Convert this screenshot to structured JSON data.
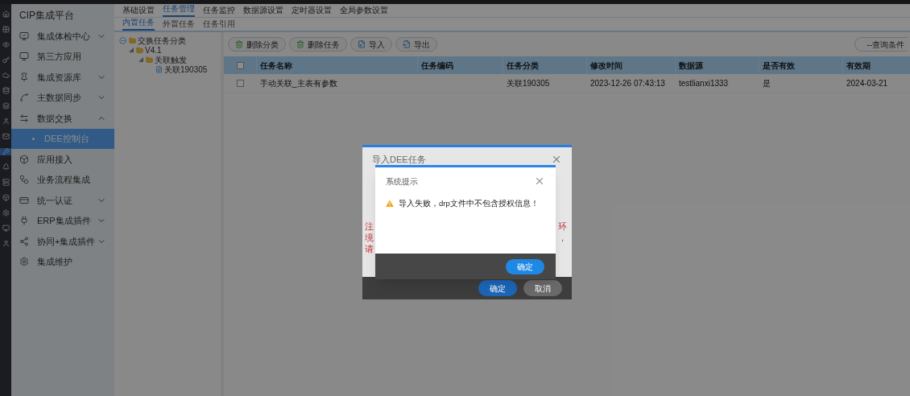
{
  "sidebar": {
    "title": "CIP集成平台",
    "items": [
      {
        "label": "集成体检中心",
        "expanded": false
      },
      {
        "label": "第三方应用"
      },
      {
        "label": "集成资源库",
        "expanded": false
      },
      {
        "label": "主数据同步",
        "expanded": false
      },
      {
        "label": "数据交换",
        "expanded": true,
        "children": [
          {
            "label": "DEE控制台",
            "selected": true
          }
        ]
      },
      {
        "label": "应用接入"
      },
      {
        "label": "业务流程集成"
      },
      {
        "label": "统一认证",
        "expanded": false
      },
      {
        "label": "ERP集成插件",
        "expanded": false
      },
      {
        "label": "协同+集成插件",
        "expanded": false
      },
      {
        "label": "集成维护"
      }
    ]
  },
  "top_tabs": [
    {
      "label": "基础设置",
      "selected": false
    },
    {
      "label": "任务管理",
      "selected": true
    },
    {
      "label": "任务监控",
      "selected": false
    },
    {
      "label": "数据源设置",
      "selected": false
    },
    {
      "label": "定时器设置",
      "selected": false
    },
    {
      "label": "全局参数设置",
      "selected": false
    }
  ],
  "sub_tabs": [
    {
      "label": "内置任务",
      "selected": true
    },
    {
      "label": "外置任务",
      "selected": false
    },
    {
      "label": "任务引用",
      "selected": false
    }
  ],
  "tree": [
    {
      "label": "交换任务分类",
      "kind": "root",
      "expanded": true,
      "children": [
        {
          "label": "V4.1",
          "kind": "folder",
          "expanded": true,
          "children": [
            {
              "label": "关联触发",
              "kind": "folder",
              "expanded": true,
              "children": [
                {
                  "label": "关联190305",
                  "kind": "file"
                }
              ]
            }
          ]
        }
      ]
    }
  ],
  "toolbar": [
    {
      "label": "删除分类",
      "kind": "delete"
    },
    {
      "label": "删除任务",
      "kind": "delete"
    },
    {
      "label": "导入",
      "kind": "import"
    },
    {
      "label": "导出",
      "kind": "export"
    }
  ],
  "query_button": "--查询条件",
  "table": {
    "all_checked": false,
    "columns": [
      "任务名称",
      "任务编码",
      "任务分类",
      "修改时间",
      "数据源",
      "是否有效",
      "有效期"
    ],
    "rows": [
      {
        "checked": false,
        "cells": [
          "手动关联_主表有参数",
          "",
          "关联190305",
          "2023-12-26 07:43:13",
          "testlianxi1333",
          "是",
          "2024-03-21"
        ]
      }
    ]
  },
  "import_dialog": {
    "title": "导入DEE任务",
    "note_left": [
      "注",
      "境",
      "请"
    ],
    "note_right": [
      "环",
      "，"
    ],
    "buttons": [
      {
        "label": "确定",
        "kind": "primary"
      },
      {
        "label": "取消",
        "kind": "secondary"
      }
    ]
  },
  "alert": {
    "title": "系统提示",
    "message": "导入失败，drp文件中不包含授权信息！",
    "button": "确定"
  }
}
